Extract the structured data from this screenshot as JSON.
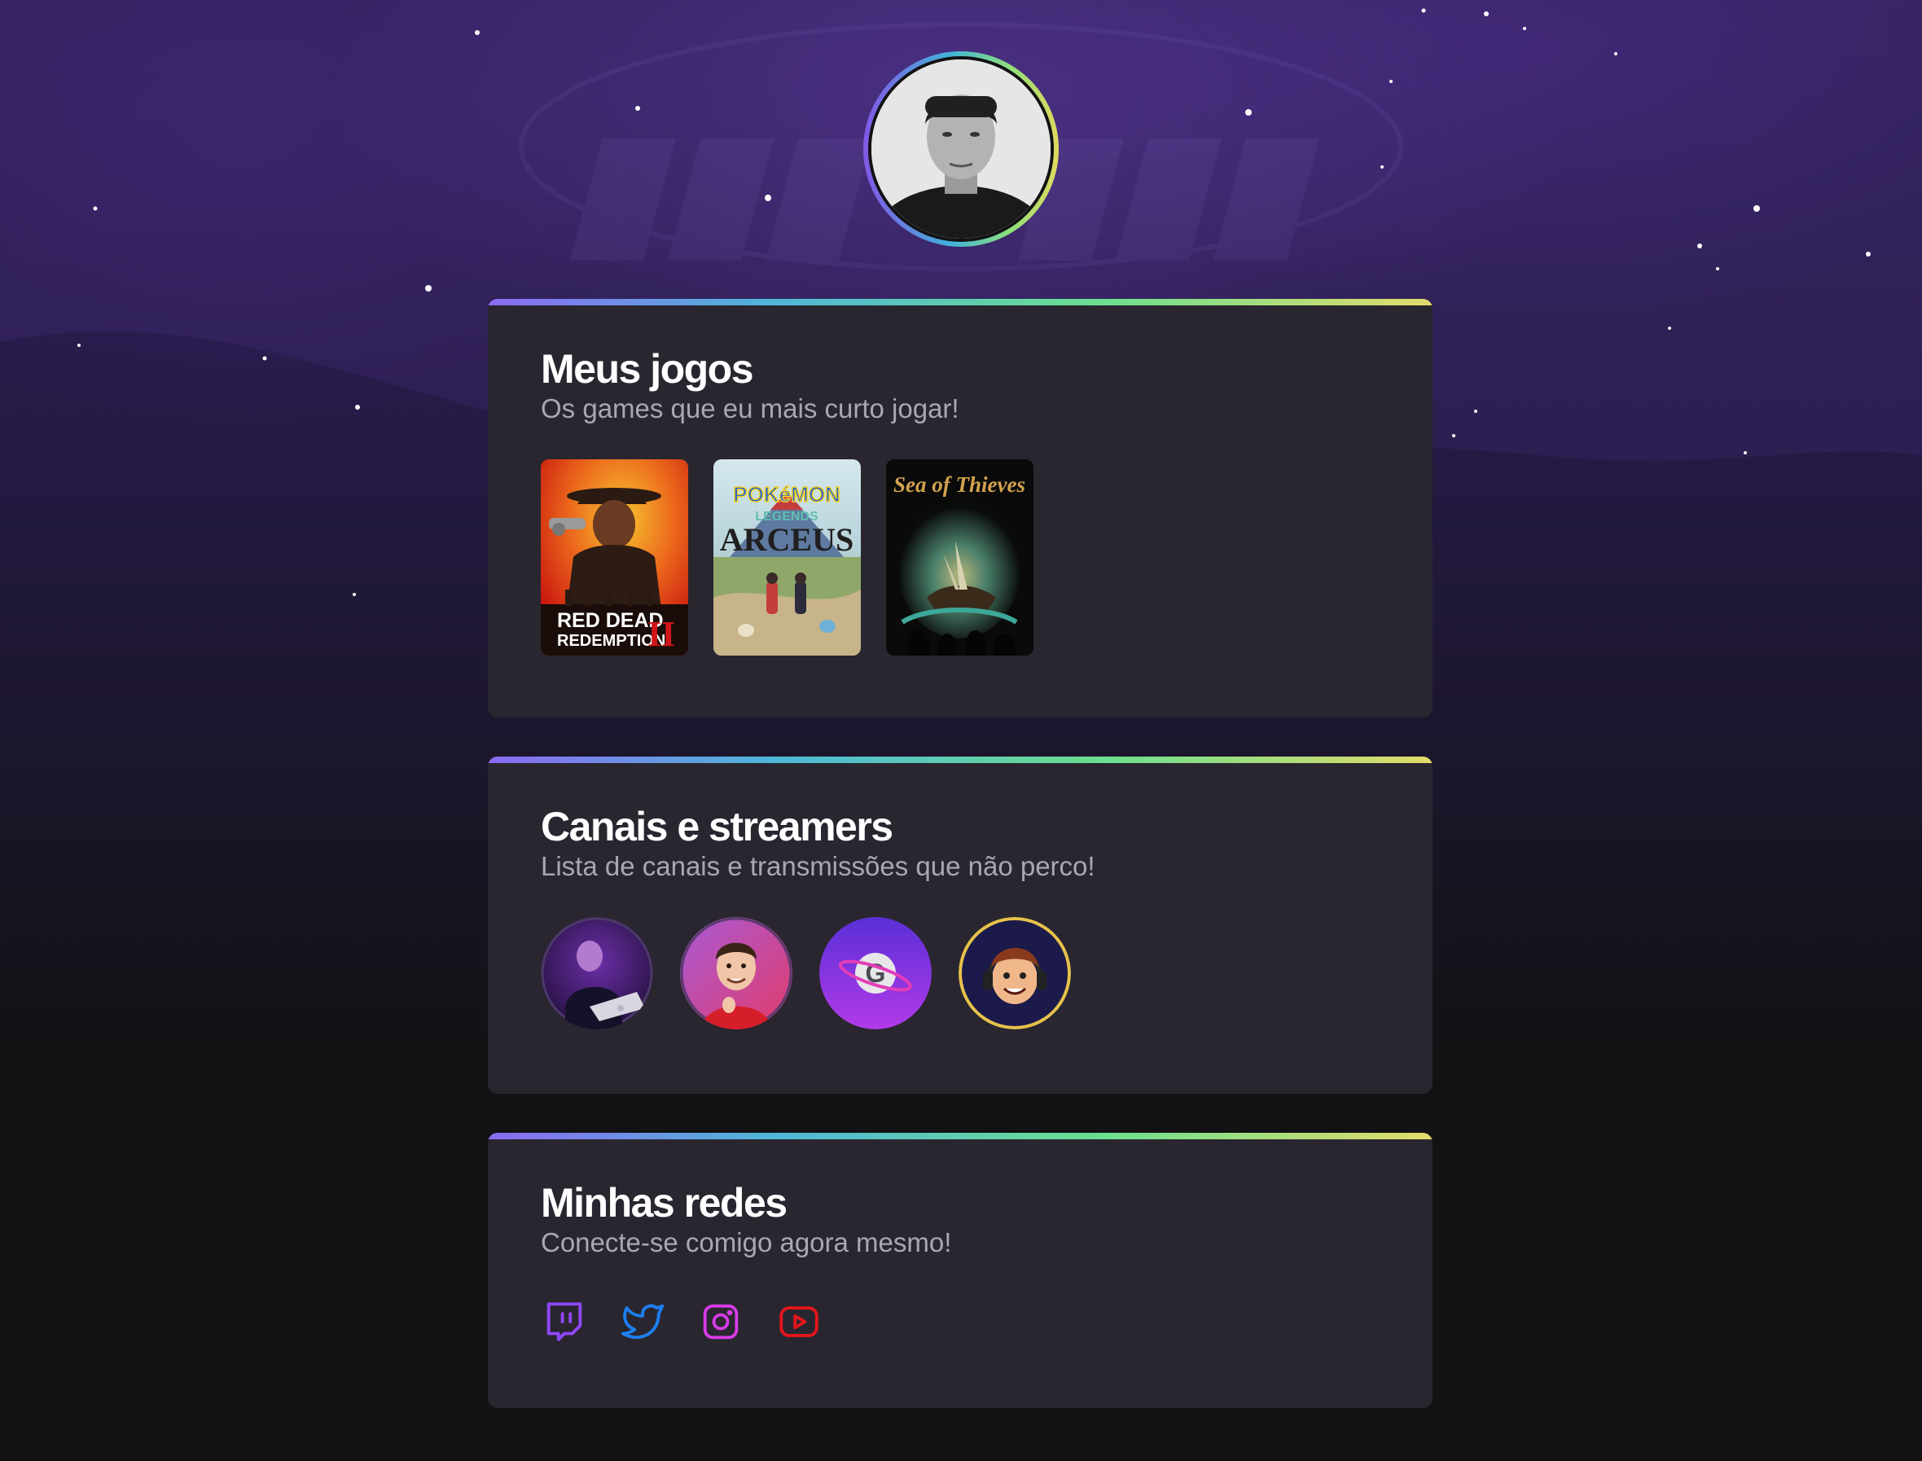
{
  "profile": {
    "name": "avatar"
  },
  "sections": {
    "games": {
      "title": "Meus jogos",
      "subtitle": "Os games que eu mais curto jogar!",
      "items": [
        {
          "name": "Red Dead Redemption II",
          "cover_line1": "RED DEAD",
          "cover_line2": "REDEMPTION",
          "cover_mark": "II"
        },
        {
          "name": "Pokémon Legends Arceus",
          "cover_line1": "POKéMON",
          "cover_line2": "LEGENDS",
          "cover_mark": "ARCEUS"
        },
        {
          "name": "Sea of Thieves",
          "cover_line1": "Sea of Thieves"
        }
      ]
    },
    "channels": {
      "title": "Canais e streamers",
      "subtitle": "Lista de canais e transmissões que não perco!",
      "items": [
        {
          "icon": "streamer-avatar-1"
        },
        {
          "icon": "streamer-avatar-2"
        },
        {
          "icon": "channel-logo-g"
        },
        {
          "icon": "streamer-cartoon-avatar"
        }
      ]
    },
    "socials": {
      "title": "Minhas redes",
      "subtitle": "Conecte-se comigo agora mesmo!",
      "items": [
        {
          "icon": "twitch-icon",
          "color": "#9147ff"
        },
        {
          "icon": "twitter-icon",
          "color": "#1d7ff0"
        },
        {
          "icon": "instagram-icon",
          "color": "#d63be8"
        },
        {
          "icon": "youtube-icon",
          "color": "#e3161b"
        }
      ]
    }
  },
  "colors": {
    "page_bg": "#121214",
    "card_bg": "#29262f",
    "title": "#ffffff",
    "subtitle": "#a8a8b3",
    "gradient": [
      "#8b6af2",
      "#4fb6d9",
      "#6adf8f",
      "#e3db6a"
    ]
  }
}
